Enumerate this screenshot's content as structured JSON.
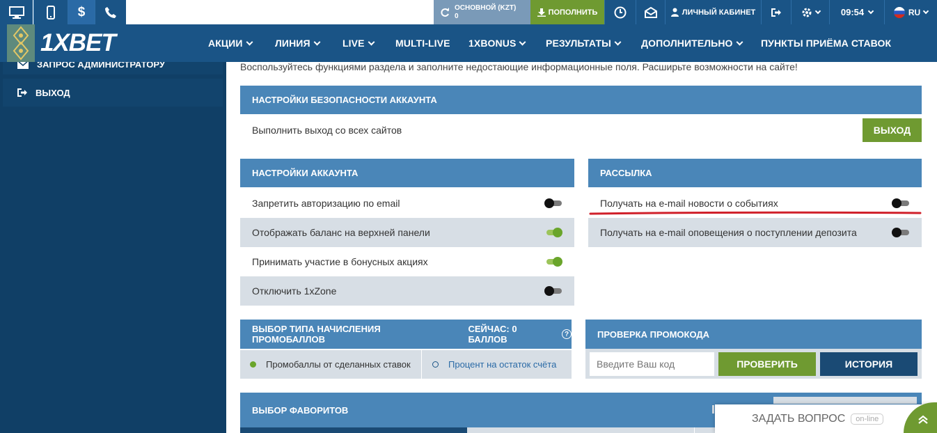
{
  "topbar": {
    "icons": [
      "desktop-icon",
      "mobile-icon",
      "dollar-icon",
      "phone-icon"
    ],
    "balance": {
      "label": "ОСНОВНОЙ (KZT)",
      "value": "0"
    },
    "deposit_label": "ПОПОЛНИТЬ",
    "cabinet_label": "ЛИЧНЫЙ КАБИНЕТ",
    "time": "09:54",
    "language": "RU"
  },
  "brand": {
    "logo": "1XBET"
  },
  "nav": {
    "items": [
      {
        "label": "АКЦИИ",
        "dropdown": true
      },
      {
        "label": "ЛИНИЯ",
        "dropdown": true
      },
      {
        "label": "LIVE",
        "dropdown": true
      },
      {
        "label": "MULTI-LIVE",
        "dropdown": false
      },
      {
        "label": "1XBONUS",
        "dropdown": true
      },
      {
        "label": "РЕЗУЛЬТАТЫ",
        "dropdown": true
      },
      {
        "label": "ДОПОЛНИТЕЛЬНО",
        "dropdown": true
      },
      {
        "label": "ПУНКТЫ ПРИЁМА СТАВОК",
        "dropdown": false
      }
    ]
  },
  "sidebar": {
    "items": [
      {
        "label": "ЗАПРОС АДМИНИСТРАТОРУ",
        "icon": "envelope-icon"
      },
      {
        "label": "ВЫХОД",
        "icon": "logout-icon"
      }
    ]
  },
  "intro_text": "Воспользуйтесь функциями раздела и заполните недостающие информационные поля. Расширьте возможности на сайте!",
  "security": {
    "title": "НАСТРОЙКИ БЕЗОПАСНОСТИ АККАУНТА",
    "logout_all_text": "Выполнить выход со всех сайтов",
    "logout_button": "ВЫХОД"
  },
  "account_settings": {
    "title": "НАСТРОЙКИ АККАУНТА",
    "rows": [
      {
        "label": "Запретить авторизацию по email",
        "on": false
      },
      {
        "label": "Отображать баланс на верхней панели",
        "on": true
      },
      {
        "label": "Принимать участие в бонусных акциях",
        "on": true
      },
      {
        "label": "Отключить 1xZone",
        "on": false
      }
    ]
  },
  "mailing": {
    "title": "РАССЫЛКА",
    "rows": [
      {
        "label": "Получать на e-mail новости о событиях",
        "on": false
      },
      {
        "label": "Получать на e-mail оповещения о поступлении депозита",
        "on": false
      }
    ],
    "highlight_color": "#d0202a"
  },
  "promo_points": {
    "title": "ВЫБОР ТИПА НАЧИСЛЕНИЯ ПРОМОБАЛЛОВ",
    "now_label": "СЕЙЧАС: 0 БАЛЛОВ",
    "options": [
      {
        "label": "Промобаллы от сделанных ставок",
        "selected": true
      },
      {
        "label": "Процент на остаток счёта",
        "selected": false
      }
    ]
  },
  "promo_check": {
    "title": "ПРОВЕРКА ПРОМОКОДА",
    "input_placeholder": "Введите Ваш код",
    "check_button": "ПРОВЕРИТЬ",
    "history_button": "ИСТОРИЯ"
  },
  "favorites": {
    "title": "ВЫБОР ФАВОРИТОВ"
  },
  "chat": {
    "label": "ЗАДАТЬ ВОПРОС",
    "status": "on-line"
  },
  "colors": {
    "brand_blue": "#1a5486",
    "accent_green": "#6f9a31",
    "section_blue": "#4a86b8"
  }
}
